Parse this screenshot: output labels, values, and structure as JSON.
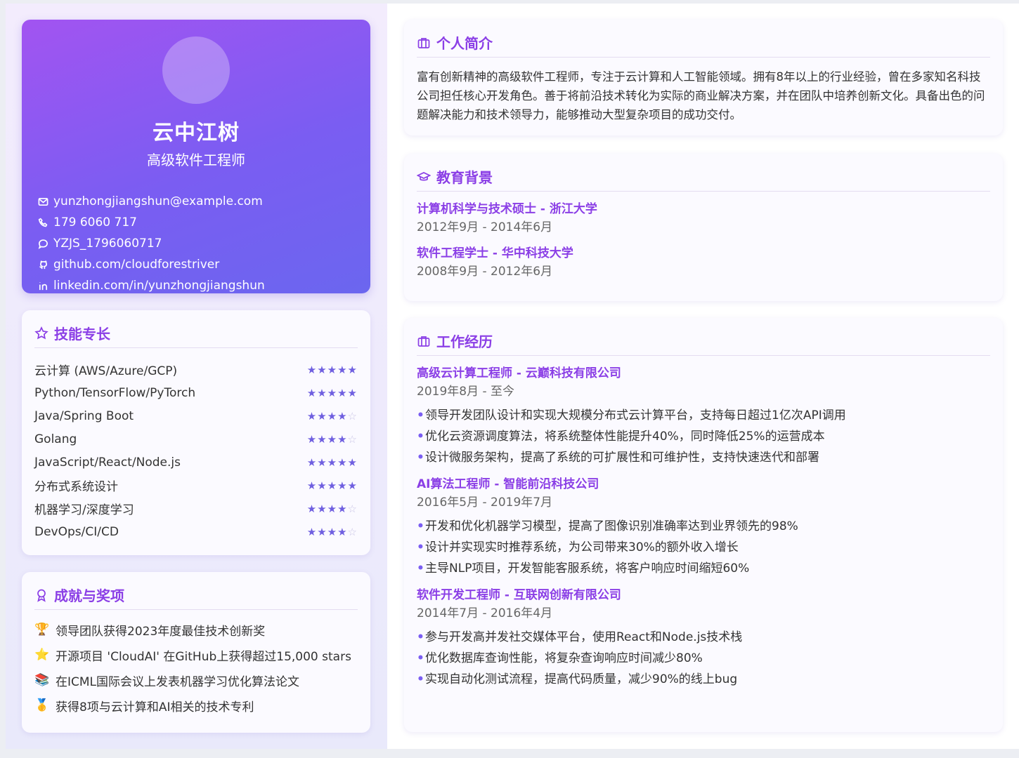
{
  "profile": {
    "name": "云中江树",
    "title": "高级软件工程师",
    "contacts": [
      {
        "icon": "mail-icon",
        "text": "yunzhongjiangshun@example.com"
      },
      {
        "icon": "phone-icon",
        "text": "179 6060 717"
      },
      {
        "icon": "wechat-icon",
        "text": "YZJS_1796060717"
      },
      {
        "icon": "github-icon",
        "text": "github.com/cloudforestriver"
      },
      {
        "icon": "linkedin-icon",
        "text": "linkedin.com/in/yunzhongjiangshun"
      }
    ]
  },
  "skills": {
    "heading": "技能专长",
    "items": [
      {
        "name": "云计算 (AWS/Azure/GCP)",
        "rating": 5
      },
      {
        "name": "Python/TensorFlow/PyTorch",
        "rating": 5
      },
      {
        "name": "Java/Spring Boot",
        "rating": 4
      },
      {
        "name": "Golang",
        "rating": 4
      },
      {
        "name": "JavaScript/React/Node.js",
        "rating": 5
      },
      {
        "name": "分布式系统设计",
        "rating": 5
      },
      {
        "name": "机器学习/深度学习",
        "rating": 4
      },
      {
        "name": "DevOps/CI/CD",
        "rating": 4
      }
    ],
    "max_rating": 5
  },
  "awards": {
    "heading": "成就与奖项",
    "items": [
      {
        "emoji": "🏆",
        "text": "领导团队获得2023年度最佳技术创新奖"
      },
      {
        "emoji": "⭐",
        "text": "开源项目 'CloudAI' 在GitHub上获得超过15,000 stars"
      },
      {
        "emoji": "📚",
        "text": "在ICML国际会议上发表机器学习优化算法论文"
      },
      {
        "emoji": "🥇",
        "text": "获得8项与云计算和AI相关的技术专利"
      }
    ]
  },
  "intro": {
    "heading": "个人简介",
    "text": "富有创新精神的高级软件工程师，专注于云计算和人工智能领域。拥有8年以上的行业经验，曾在多家知名科技公司担任核心开发角色。善于将前沿技术转化为实际的商业解决方案，并在团队中培养创新文化。具备出色的问题解决能力和技术领导力，能够推动大型复杂项目的成功交付。"
  },
  "education": {
    "heading": "教育背景",
    "items": [
      {
        "title": "计算机科学与技术硕士 - 浙江大学",
        "date": "2012年9月 - 2014年6月"
      },
      {
        "title": "软件工程学士 - 华中科技大学",
        "date": "2008年9月 - 2012年6月"
      }
    ]
  },
  "work": {
    "heading": "工作经历",
    "items": [
      {
        "title": "高级云计算工程师 - 云巅科技有限公司",
        "date": "2019年8月 - 至今",
        "bullets": [
          "领导开发团队设计和实现大规模分布式云计算平台，支持每日超过1亿次API调用",
          "优化云资源调度算法，将系统整体性能提升40%，同时降低25%的运营成本",
          "设计微服务架构，提高了系统的可扩展性和可维护性，支持快速迭代和部署"
        ]
      },
      {
        "title": "AI算法工程师 - 智能前沿科技公司",
        "date": "2016年5月 - 2019年7月",
        "bullets": [
          "开发和优化机器学习模型，提高了图像识别准确率达到业界领先的98%",
          "设计并实现实时推荐系统，为公司带来30%的额外收入增长",
          "主导NLP项目，开发智能客服系统，将客户响应时间缩短60%"
        ]
      },
      {
        "title": "软件开发工程师 - 互联网创新有限公司",
        "date": "2014年7月 - 2016年4月",
        "bullets": [
          "参与开发高并发社交媒体平台，使用React和Node.js技术栈",
          "优化数据库查询性能，将复杂查询响应时间减少80%",
          "实现自动化测试流程，提高代码质量，减少90%的线上bug"
        ]
      }
    ]
  },
  "colors": {
    "accent": "#8b3fe6",
    "star": "#6f5fe0",
    "gradient_start": "#a254f1",
    "gradient_end": "#6b66ef"
  }
}
